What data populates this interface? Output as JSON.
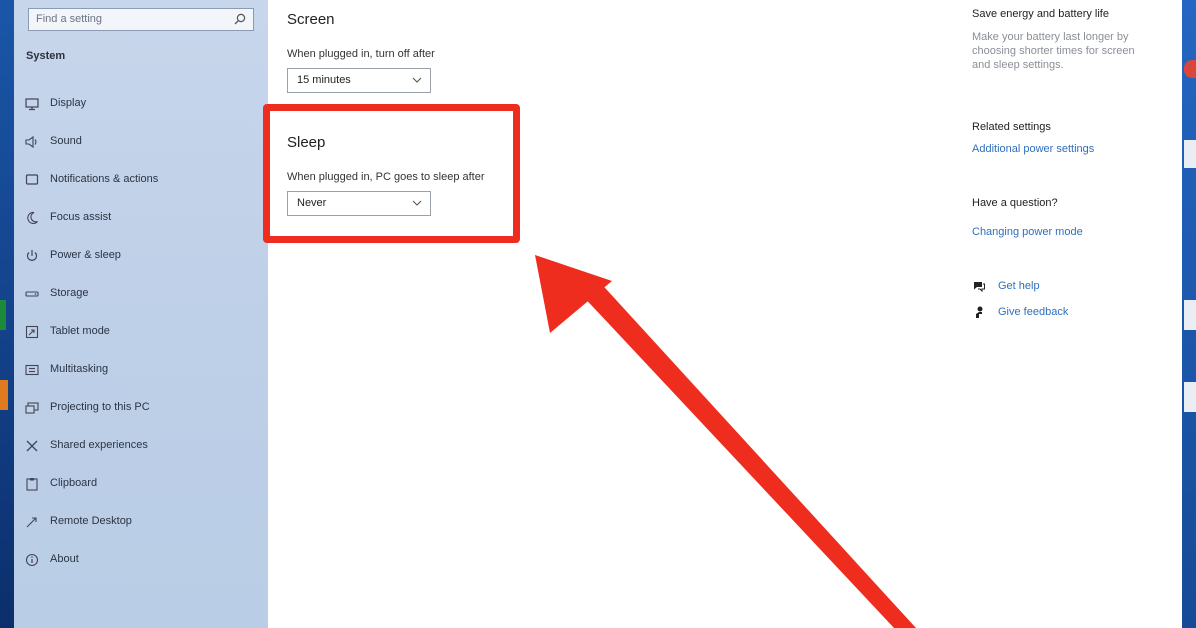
{
  "search": {
    "placeholder": "Find a setting"
  },
  "sidebar": {
    "section_title": "System",
    "items": [
      {
        "label": "Display",
        "icon": "monitor-icon"
      },
      {
        "label": "Sound",
        "icon": "speaker-icon"
      },
      {
        "label": "Notifications & actions",
        "icon": "notification-icon"
      },
      {
        "label": "Focus assist",
        "icon": "moon-icon"
      },
      {
        "label": "Power & sleep",
        "icon": "power-icon"
      },
      {
        "label": "Storage",
        "icon": "storage-icon"
      },
      {
        "label": "Tablet mode",
        "icon": "tablet-icon"
      },
      {
        "label": "Multitasking",
        "icon": "multitasking-icon"
      },
      {
        "label": "Projecting to this PC",
        "icon": "projector-icon"
      },
      {
        "label": "Shared experiences",
        "icon": "shared-icon"
      },
      {
        "label": "Clipboard",
        "icon": "clipboard-icon"
      },
      {
        "label": "Remote Desktop",
        "icon": "remote-desktop-icon"
      },
      {
        "label": "About",
        "icon": "info-icon"
      }
    ]
  },
  "main": {
    "screen": {
      "heading": "Screen",
      "plugged_label": "When plugged in, turn off after",
      "plugged_value": "15 minutes"
    },
    "sleep": {
      "heading": "Sleep",
      "plugged_label": "When plugged in, PC goes to sleep after",
      "plugged_value": "Never"
    }
  },
  "right_panel": {
    "tip_title": "Save energy and battery life",
    "tip_text": "Make your battery last longer by choosing shorter times for screen and sleep settings.",
    "related_title": "Related settings",
    "related_link": "Additional power settings",
    "question_title": "Have a question?",
    "question_link": "Changing power mode",
    "get_help": "Get help",
    "give_feedback": "Give feedback"
  },
  "colors": {
    "highlight": "#ee2d1f",
    "link": "#2f6fbf",
    "sidebar_bg": "#c3d3ea"
  }
}
